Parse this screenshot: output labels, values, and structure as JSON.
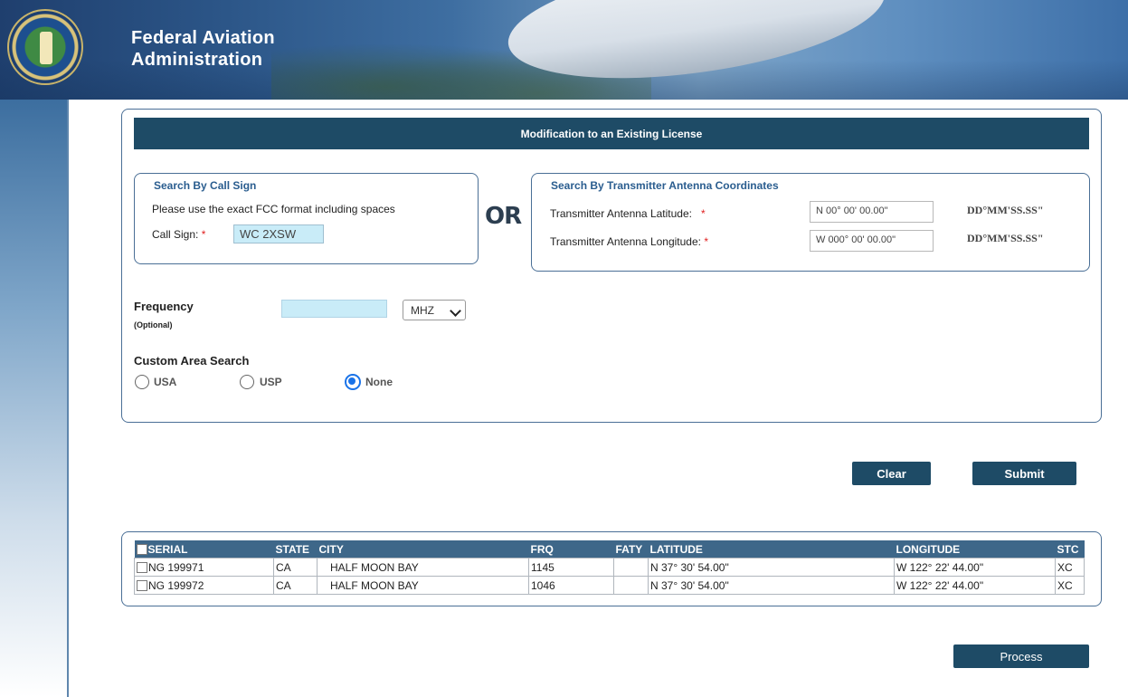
{
  "header": {
    "title_line1": "Federal Aviation",
    "title_line2": "Administration"
  },
  "form": {
    "title": "Modification to an Existing License",
    "call_sign_box": {
      "title": "Search By Call Sign",
      "hint": "Please use the exact FCC format including spaces",
      "label": "Call Sign:",
      "value": "WC 2XSW"
    },
    "or_label": "OR",
    "coords_box": {
      "title": "Search By Transmitter Antenna Coordinates",
      "lat_label": "Transmitter Antenna Latitude:",
      "lat_value": "N 00° 00' 00.00\"",
      "lon_label": "Transmitter Antenna Longitude:",
      "lon_value": "W 000° 00' 00.00\"",
      "format": "DD°MM'SS.SS\""
    },
    "frequency": {
      "label": "Frequency",
      "optional": "(Optional)",
      "value": "",
      "unit": "MHZ"
    },
    "custom_area": {
      "label": "Custom Area Search",
      "options": [
        "USA",
        "USP",
        "None"
      ],
      "selected": "None"
    },
    "clear_label": "Clear",
    "submit_label": "Submit"
  },
  "results": {
    "columns": [
      "SERIAL",
      "STATE",
      "CITY",
      "FRQ",
      "FATY",
      "LATITUDE",
      "LONGITUDE",
      "STC"
    ],
    "rows": [
      [
        "NG 199971",
        "CA",
        "HALF MOON BAY",
        "1145",
        "",
        "N 37° 30' 54.00\"",
        "W 122° 22' 44.00\"",
        "XC"
      ],
      [
        "NG 199972",
        "CA",
        "HALF MOON BAY",
        "1046",
        "",
        "N 37° 30' 54.00\"",
        "W 122° 22' 44.00\"",
        "XC"
      ]
    ]
  },
  "process_label": "Process",
  "colors": {
    "accent": "#1e4b66",
    "table_header": "#3e6789",
    "box_title": "#2a5d8f",
    "radio_selected": "#1a73e8"
  }
}
